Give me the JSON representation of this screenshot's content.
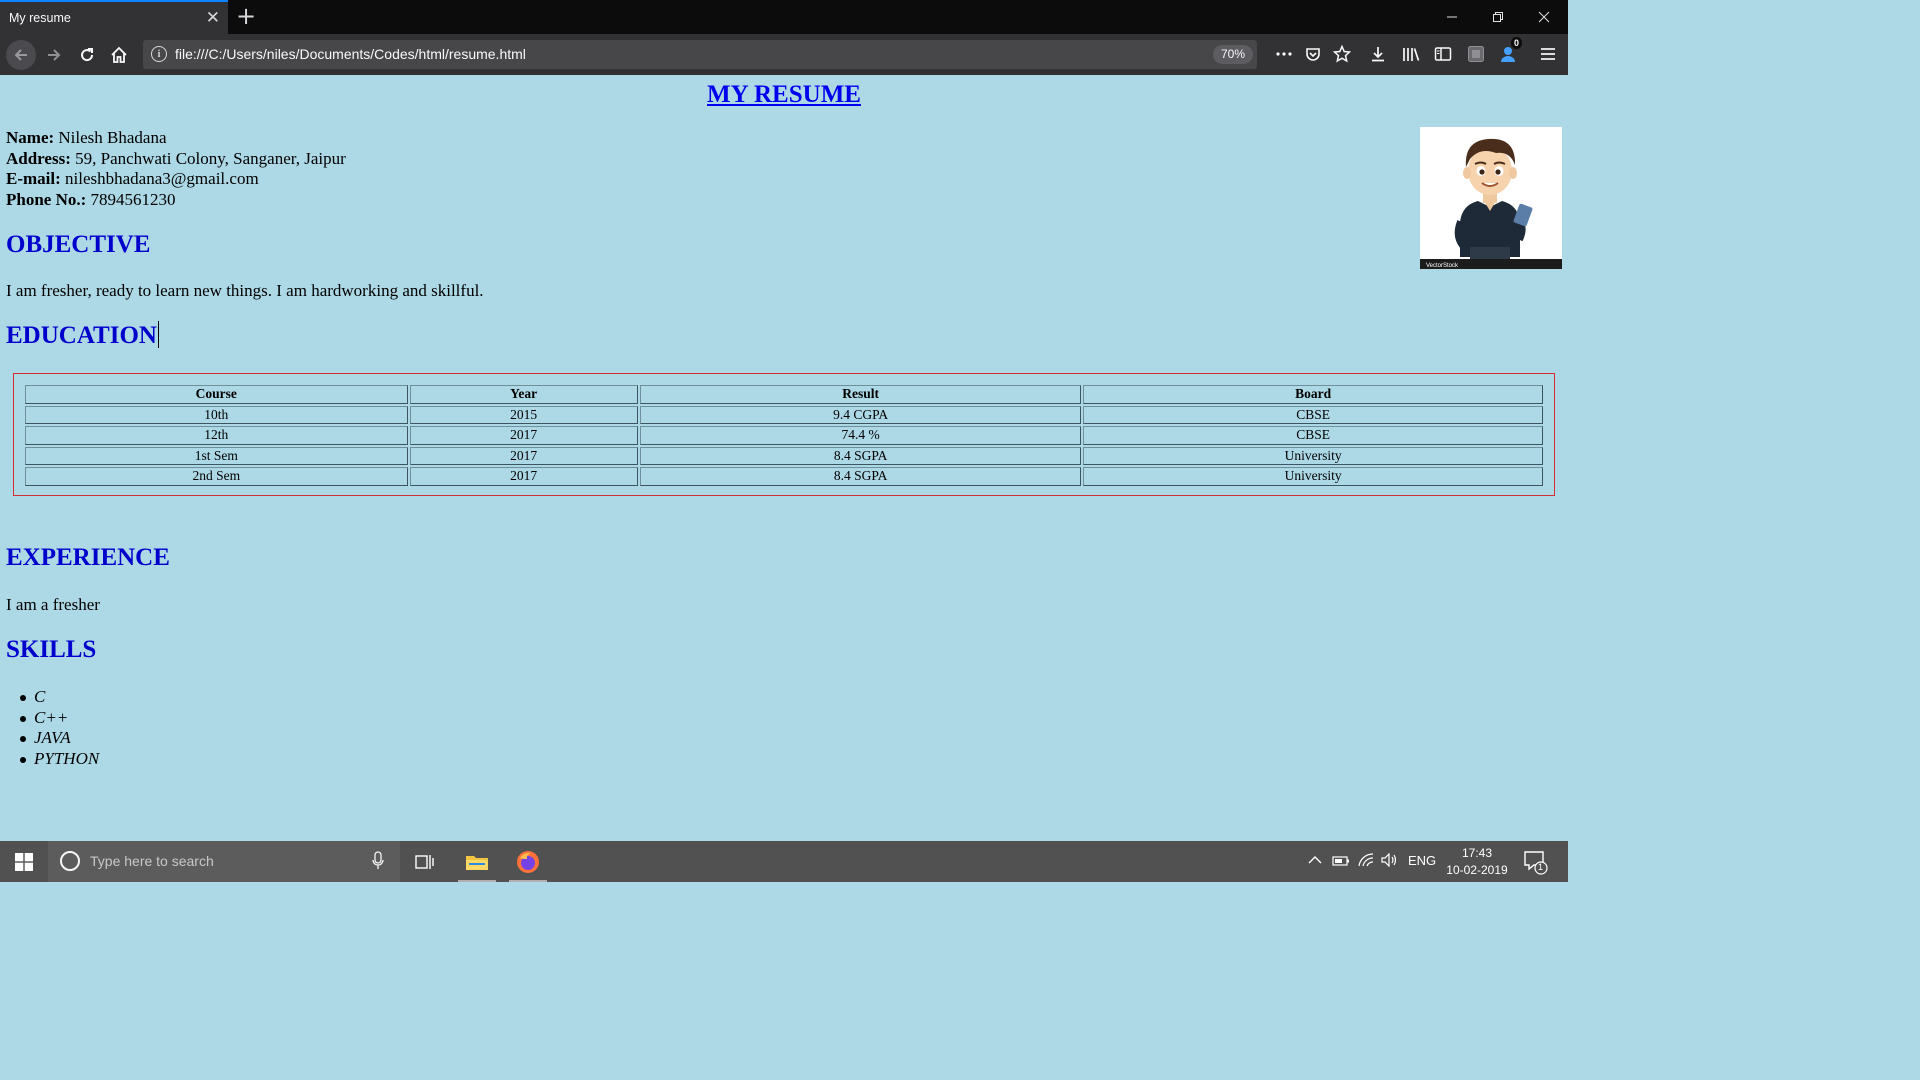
{
  "browser": {
    "tab_title": "My resume",
    "tab_close": "✕",
    "new_tab": "+",
    "url": "file:///C:/Users/niles/Documents/Codes/html/resume.html",
    "zoom": "70%",
    "notification_badge": "0"
  },
  "page": {
    "title": "MY RESUME",
    "info": [
      {
        "label": "Name:",
        "value": " Nilesh Bhadana"
      },
      {
        "label": "Address:",
        "value": " 59, Panchwati Colony, Sanganer, Jaipur"
      },
      {
        "label": "E-mail:",
        "value": " nileshbhadana3@gmail.com"
      },
      {
        "label": "Phone No.:",
        "value": " 7894561230"
      }
    ],
    "objective_heading": "OBJECTIVE",
    "objective_text": "I am fresher, ready to learn new things. I am hardworking and skillful.",
    "education_heading": "EDUCATION",
    "education_table": {
      "headers": [
        "Course",
        "Year",
        "Result",
        "Board"
      ],
      "rows": [
        [
          "10th",
          "2015",
          "9.4 CGPA",
          "CBSE"
        ],
        [
          "12th",
          "2017",
          "74.4 %",
          "CBSE"
        ],
        [
          "1st Sem",
          "2017",
          "8.4 SGPA",
          "University"
        ],
        [
          "2nd Sem",
          "2017",
          "8.4 SGPA",
          "University"
        ]
      ]
    },
    "experience_heading": "EXPERIENCE",
    "experience_text": "I am a fresher",
    "skills_heading": "SKILLS",
    "skills": [
      "C",
      "C++",
      "JAVA",
      "PYTHON"
    ],
    "photo_watermark": "VectorStock"
  },
  "taskbar": {
    "search_placeholder": "Type here to search",
    "language": "ENG",
    "time": "17:43",
    "date": "10-02-2019",
    "notification_count": "1"
  }
}
